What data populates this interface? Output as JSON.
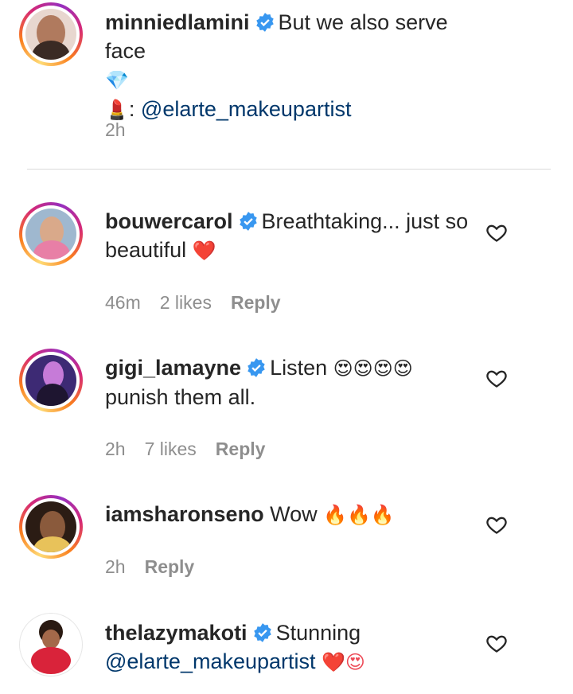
{
  "comments": [
    {
      "username": "minniedlamini",
      "text_before": "But we also serve face",
      "emoji_1": "💎",
      "emoji_2": "💄",
      "separator": ":",
      "mention": "@elarte_makeupartist",
      "time": "2h"
    },
    {
      "username": "bouwercarol",
      "text": "Breathtaking... just so beautiful",
      "emoji": "❤️",
      "time": "46m",
      "likes": "2 likes",
      "reply": "Reply"
    },
    {
      "username": "gigi_lamayne",
      "text_1": "Listen",
      "emoji": "😍😍😍😍",
      "text_2": "punish them all.",
      "time": "2h",
      "likes": "7 likes",
      "reply": "Reply"
    },
    {
      "username": "iamsharonseno",
      "text": "Wow",
      "emoji": "🔥🔥🔥",
      "time": "2h",
      "reply": "Reply"
    },
    {
      "username": "thelazymakoti",
      "text": "Stunning",
      "mention": "@elarte_makeupartist",
      "emoji": "❤️😍"
    }
  ],
  "colors": {
    "verified": "#3897f0",
    "mention": "#00376b",
    "meta": "#8e8e8e"
  }
}
